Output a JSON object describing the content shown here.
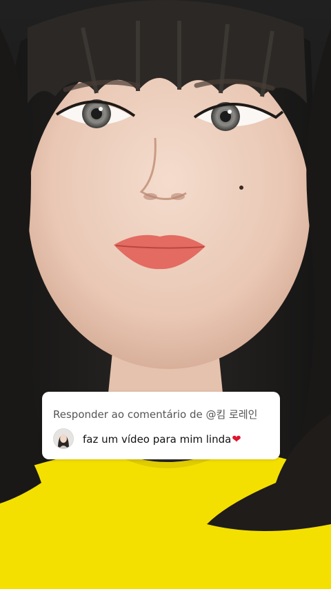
{
  "reply_card": {
    "header": "Responder ao comentário de @킴 로레인",
    "comment": "faz um vídeo para mim linda"
  },
  "icons": {
    "heart": "heart-icon",
    "avatar": "user-avatar"
  },
  "colors": {
    "shirt": "#f4e000",
    "heart": "#e0142c",
    "card_background": "#ffffff"
  }
}
